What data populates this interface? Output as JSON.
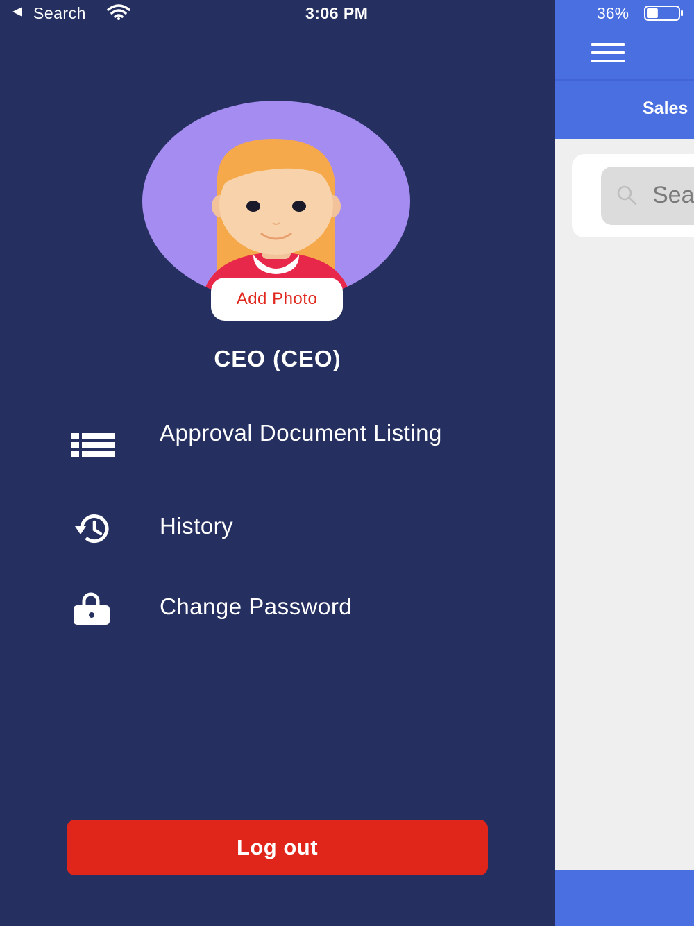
{
  "status_bar": {
    "back_label": "Search",
    "time": "3:06 PM",
    "battery": "36%",
    "battery_level": 0.36
  },
  "drawer": {
    "add_photo_label": "Add Photo",
    "user_name": "CEO (CEO)",
    "menu": [
      {
        "label": "Approval Document Listing",
        "icon": "list-icon"
      },
      {
        "label": "History",
        "icon": "history-icon"
      },
      {
        "label": "Change Password",
        "icon": "lock-icon"
      }
    ],
    "logout_label": "Log out"
  },
  "underlay": {
    "tab_label": "Sales",
    "search_placeholder": "Sea"
  },
  "colors": {
    "drawer_bg": "#253060",
    "accent_blue": "#4a6fe0",
    "logout_red": "#e0261a",
    "add_photo_text": "#e0281e"
  }
}
